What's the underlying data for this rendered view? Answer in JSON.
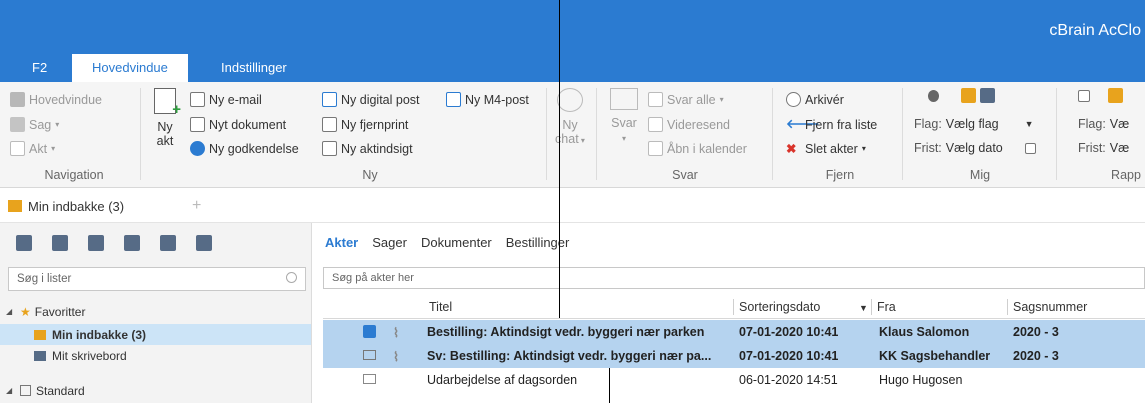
{
  "app": {
    "title": "cBrain AcClo"
  },
  "ribbon_tabs": [
    {
      "label": "F2"
    },
    {
      "label": "Hovedvindue"
    },
    {
      "label": "Indstillinger"
    }
  ],
  "ribbon": {
    "navigation": {
      "items": [
        "Hovedvindue",
        "Sag",
        "Akt"
      ],
      "group_label": "Navigation"
    },
    "ny": {
      "big_button": {
        "line1": "Ny",
        "line2": "akt"
      },
      "col1": [
        "Ny e-mail",
        "Nyt dokument",
        "Ny godkendelse"
      ],
      "col2": [
        "Ny digital post",
        "Ny fjernprint",
        "Ny aktindsigt"
      ],
      "col3": [
        "Ny M4-post"
      ],
      "group_label": "Ny"
    },
    "chat": {
      "line1": "Ny",
      "line2": "chat"
    },
    "svar": {
      "big_button": {
        "label": "Svar"
      },
      "items": [
        "Svar alle",
        "Videresend",
        "Åbn i kalender"
      ],
      "group_label": "Svar"
    },
    "fjern": {
      "items": [
        "Arkivér",
        "Fjern fra liste",
        "Slet akter"
      ],
      "group_label": "Fjern"
    },
    "mig": {
      "flag_label": "Flag:",
      "flag_value": "Vælg flag",
      "frist_label": "Frist:",
      "frist_value": "Vælg dato",
      "group_label": "Mig"
    },
    "rapp": {
      "flag_label": "Flag:",
      "flag_value": "Væ",
      "frist_label": "Frist:",
      "frist_value": "Væ",
      "group_label": "Rapp"
    }
  },
  "doc_tab": {
    "label": "Min indbakke (3)"
  },
  "left_panel": {
    "search_placeholder": "Søg i lister",
    "tree": [
      {
        "label": "Favoritter"
      },
      {
        "label": "Min indbakke (3)"
      },
      {
        "label": "Mit skrivebord"
      },
      {
        "label": "Standard"
      }
    ]
  },
  "main": {
    "view_tabs": [
      "Akter",
      "Sager",
      "Dokumenter",
      "Bestillinger"
    ],
    "search_placeholder": "Søg på akter her",
    "columns": [
      "Titel",
      "Sorteringsdato",
      "Fra",
      "Sagsnummer"
    ],
    "rows": [
      {
        "title": "Bestilling: Aktindsigt vedr. byggeri nær parken",
        "date": "07-01-2020 10:41",
        "from": "Klaus Salomon",
        "case": "2020 - 3"
      },
      {
        "title": "Sv: Bestilling: Aktindsigt vedr. byggeri nær pa...",
        "date": "07-01-2020 10:41",
        "from": "KK Sagsbehandler",
        "case": "2020 - 3"
      },
      {
        "title": "Udarbejdelse af dagsorden",
        "date": "06-01-2020 14:51",
        "from": "Hugo Hugosen",
        "case": ""
      }
    ]
  },
  "colors": {
    "accent": "#2b7bd1",
    "selection": "#b5d3ef"
  }
}
